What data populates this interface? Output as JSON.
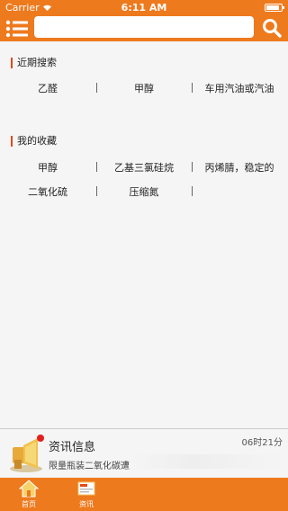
{
  "status_bar": {
    "carrier": "Carrier",
    "time": "6:11 AM"
  },
  "search": {
    "placeholder": ""
  },
  "recent_search": {
    "title": "近期搜索",
    "items": [
      "乙醛",
      "甲醇",
      "车用汽油或汽油"
    ]
  },
  "favorites": {
    "title": "我的收藏",
    "items": [
      "甲醇",
      "乙基三氯硅烷",
      "丙烯腈，稳定的",
      "二氧化硫",
      "压缩氮"
    ]
  },
  "news": {
    "title": "资讯信息",
    "time": "06时21分",
    "snippet": "限量瓶装二氧化碳遭"
  },
  "tabbar": {
    "items": [
      {
        "label": "首页",
        "icon": "home-icon"
      },
      {
        "label": "资讯",
        "icon": "news-icon"
      }
    ]
  },
  "colors": {
    "accent": "#ee7a1e",
    "section_bar": "#e24a1a",
    "badge": "#e21f1f"
  }
}
